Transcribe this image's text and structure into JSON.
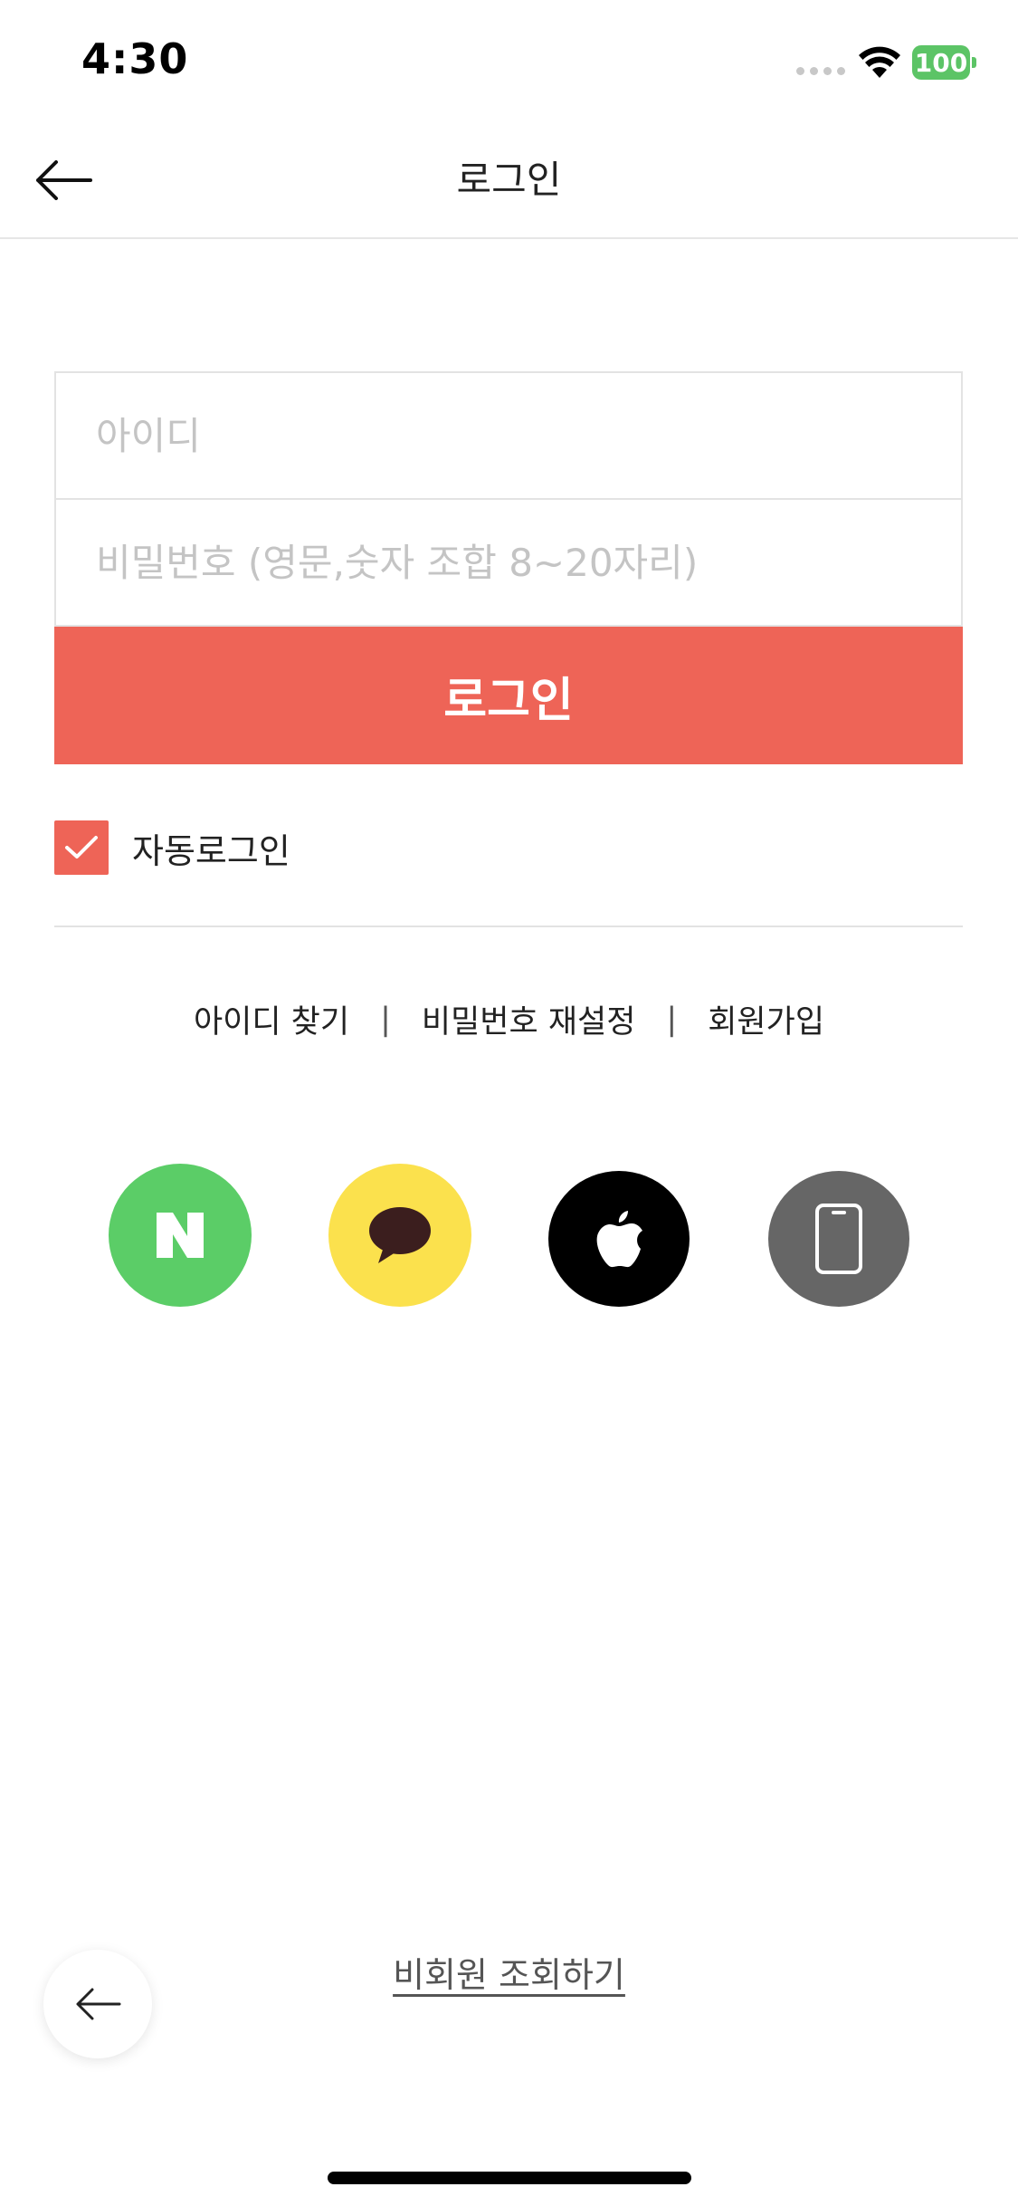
{
  "status_bar": {
    "time": "4:30",
    "battery": "100"
  },
  "header": {
    "title": "로그인"
  },
  "form": {
    "id_placeholder": "아이디",
    "password_placeholder": "비밀번호 (영문,숫자 조합 8~20자리)",
    "login_label": "로그인",
    "auto_login_label": "자동로그인",
    "auto_login_checked": true
  },
  "links": {
    "find_id": "아이디 찾기",
    "separator": "|",
    "reset_password": "비밀번호 재설정",
    "signup": "회원가입"
  },
  "social": [
    {
      "icon": "naver-icon",
      "color": "#5bcd67"
    },
    {
      "icon": "kakao-icon",
      "color": "#fbe14d"
    },
    {
      "icon": "apple-icon",
      "color": "#000000"
    },
    {
      "icon": "phone-icon",
      "color": "#666666"
    }
  ],
  "guest": {
    "label": "비회원 조회하기"
  },
  "colors": {
    "accent": "#ee6457",
    "divider": "#e3e3e3"
  }
}
